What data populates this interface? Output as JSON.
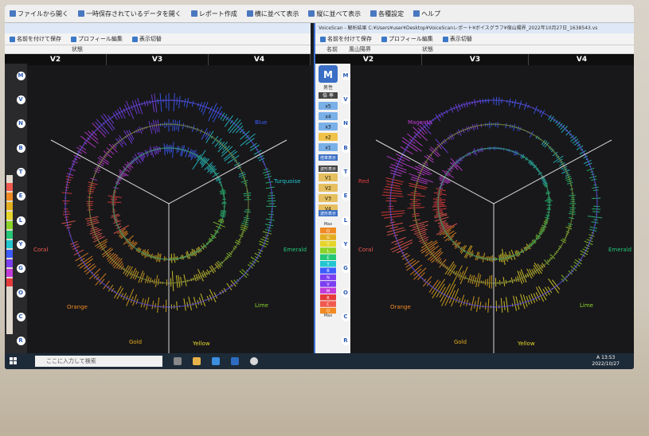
{
  "menubar": {
    "items": [
      "ファイルから開く",
      "一時保存されているデータを開く",
      "レポート作成",
      "横に並べて表示",
      "縦に並べて表示",
      "各種設定",
      "ヘルプ"
    ]
  },
  "left_window": {
    "toolbar": [
      "名前を付けて保存",
      "プロフィール編集",
      "表示切替"
    ],
    "columns": [
      "状態"
    ],
    "bands": [
      "V2",
      "V3",
      "V4"
    ],
    "color_labels": [
      "Blue",
      "Turquoise",
      "Emerald",
      "Lime",
      "Yellow",
      "Gold",
      "Orange",
      "Coral"
    ]
  },
  "right_window": {
    "title": "VoiceScan - 解析結果 C:¥Users¥user¥Desktop¥VoiceScanレポート¥ボイスグラフ¥宿山陽界_2022年10月27日_1638543.vs",
    "toolbar": [
      "名前を付けて保存",
      "プロフィール編集",
      "表示切替"
    ],
    "columns": [
      "名前",
      "風山陽界",
      "状態"
    ],
    "bands": [
      "V2",
      "V3",
      "V4"
    ],
    "gender_label": "男性",
    "magnification_label": "倍 率",
    "magnification_options": [
      "x5",
      "x4",
      "x3",
      "x2",
      "x1"
    ],
    "magnification_reset": "倍率表示",
    "wave_label": "波形表示",
    "wave_options": [
      "V1",
      "V2",
      "V3",
      "V4"
    ],
    "wave_reset": "波形表示",
    "legend_top": "Max",
    "legend_bottom": "Max",
    "legend_letters": [
      "O",
      "G",
      "Y",
      "L",
      "E",
      "T",
      "B",
      "N",
      "V",
      "M",
      "R",
      "C",
      "O"
    ],
    "color_labels": [
      "Magenta",
      "Red",
      "Coral",
      "Orange",
      "Gold",
      "Yellow",
      "Lime",
      "Emerald"
    ]
  },
  "letter_column": [
    "M",
    "V",
    "N",
    "B",
    "T",
    "E",
    "L",
    "Y",
    "G",
    "O",
    "C",
    "R"
  ],
  "taskbar": {
    "search_placeholder": "ここに入力して検索",
    "time": "13:53",
    "date": "2022/10/27",
    "ime": "A"
  },
  "colors": {
    "magenta": "#c23bd8",
    "violet": "#7b3ef0",
    "blue": "#3b5cff",
    "turquoise": "#21c6d0",
    "emerald": "#23c776",
    "lime": "#8bd329",
    "yellow": "#e6d52a",
    "gold": "#e4ad1e",
    "orange": "#f08a23",
    "coral": "#f05a4e",
    "red": "#e63b3b"
  }
}
